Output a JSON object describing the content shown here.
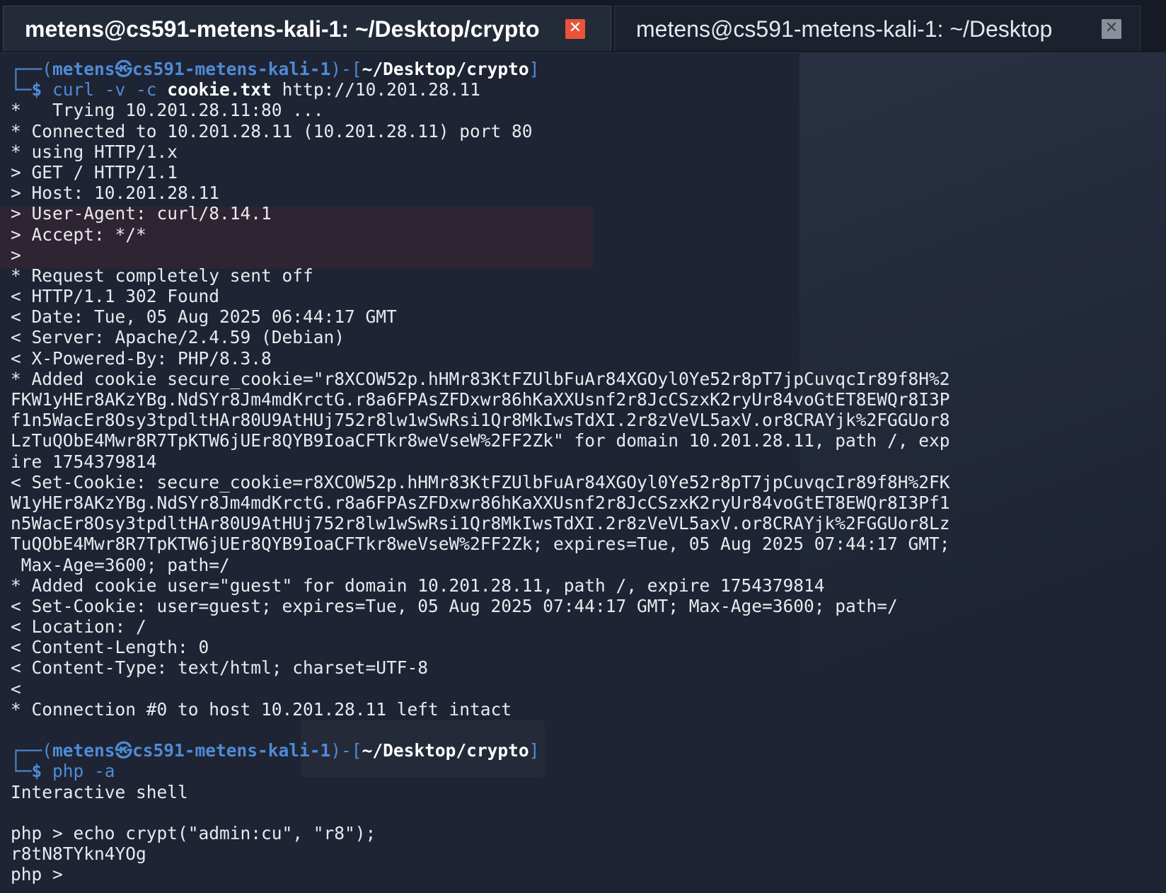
{
  "tabs": [
    {
      "label": "metens@cs591-metens-kali-1: ~/Desktop/crypto",
      "active": true,
      "close_icon": "close-icon"
    },
    {
      "label": "metens@cs591-metens-kali-1: ~/Desktop",
      "active": false,
      "close_icon": "close-icon"
    }
  ],
  "prompt1": {
    "open": "┌──(",
    "user": "metens",
    "at": "㉿",
    "host": "cs591-metens-kali-1",
    "mid": ")-[",
    "dir": "~/Desktop/crypto",
    "close": "]",
    "dollar": "└─$ ",
    "cmd": "curl",
    "args1": " -v -c ",
    "arg_file": "cookie.txt",
    "args2": " http://10.201.28.11"
  },
  "output1": [
    "*   Trying 10.201.28.11:80 ...",
    "* Connected to 10.201.28.11 (10.201.28.11) port 80",
    "* using HTTP/1.x",
    "> GET / HTTP/1.1",
    "> Host: 10.201.28.11",
    "> User-Agent: curl/8.14.1",
    "> Accept: */*",
    ">",
    "* Request completely sent off",
    "< HTTP/1.1 302 Found",
    "< Date: Tue, 05 Aug 2025 06:44:17 GMT",
    "< Server: Apache/2.4.59 (Debian)",
    "< X-Powered-By: PHP/8.3.8",
    "* Added cookie secure_cookie=\"r8XCOW52p.hHMr83KtFZUlbFuAr84XGOyl0Ye52r8pT7jpCuvqcIr89f8H%2",
    "FKW1yHEr8AKzYBg.NdSYr8Jm4mdKrctG.r8a6FPAsZFDxwr86hKaXXUsnf2r8JcCSzxK2ryUr84voGtET8EWQr8I3P",
    "f1n5WacEr8Osy3tpdltHAr80U9AtHUj752r8lw1wSwRsi1Qr8MkIwsTdXI.2r8zVeVL5axV.or8CRAYjk%2FGGUor8",
    "LzTuQObE4Mwr8R7TpKTW6jUEr8QYB9IoaCFTkr8weVseW%2FF2Zk\" for domain 10.201.28.11, path /, exp",
    "ire 1754379814",
    "< Set-Cookie: secure_cookie=r8XCOW52p.hHMr83KtFZUlbFuAr84XGOyl0Ye52r8pT7jpCuvqcIr89f8H%2FK",
    "W1yHEr8AKzYBg.NdSYr8Jm4mdKrctG.r8a6FPAsZFDxwr86hKaXXUsnf2r8JcCSzxK2ryUr84voGtET8EWQr8I3Pf1",
    "n5WacEr8Osy3tpdltHAr80U9AtHUj752r8lw1wSwRsi1Qr8MkIwsTdXI.2r8zVeVL5axV.or8CRAYjk%2FGGUor8Lz",
    "TuQObE4Mwr8R7TpKTW6jUEr8QYB9IoaCFTkr8weVseW%2FF2Zk; expires=Tue, 05 Aug 2025 07:44:17 GMT;",
    " Max-Age=3600; path=/",
    "* Added cookie user=\"guest\" for domain 10.201.28.11, path /, expire 1754379814",
    "< Set-Cookie: user=guest; expires=Tue, 05 Aug 2025 07:44:17 GMT; Max-Age=3600; path=/",
    "< Location: /",
    "< Content-Length: 0",
    "< Content-Type: text/html; charset=UTF-8",
    "<",
    "* Connection #0 to host 10.201.28.11 left intact",
    ""
  ],
  "prompt2": {
    "open": "┌──(",
    "user": "metens",
    "at": "㉿",
    "host": "cs591-metens-kali-1",
    "mid": ")-[",
    "dir": "~/Desktop/crypto",
    "close": "]",
    "dollar": "└─$ ",
    "cmd": "php",
    "args": " -a"
  },
  "output2": [
    "Interactive shell",
    "",
    "php > echo crypt(\"admin:cu\", \"r8\");",
    "r8tN8TYkn4YOg",
    "php > "
  ]
}
